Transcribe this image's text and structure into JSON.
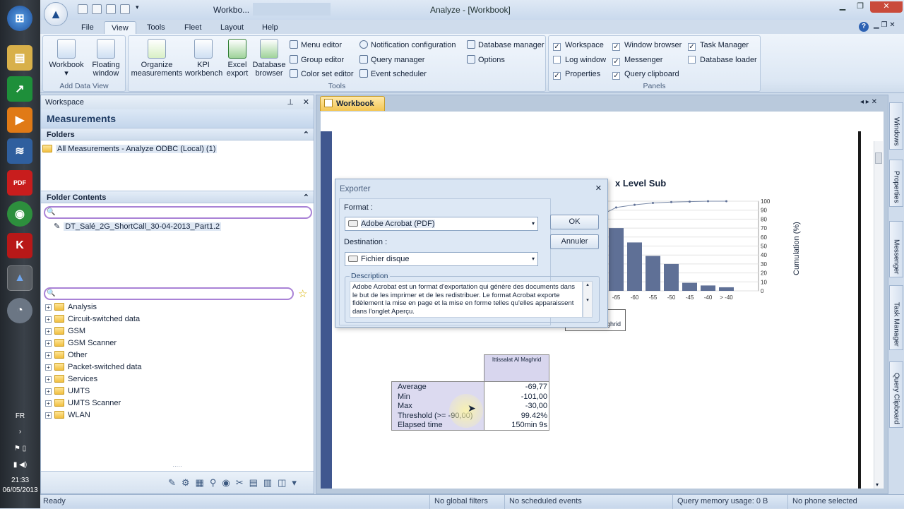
{
  "window": {
    "title": "Analyze - [Workbook]",
    "quick_access_title": "Workbo..."
  },
  "taskbar": {
    "language": "FR",
    "time": "21:33",
    "date": "06/05/2013",
    "pdf_label": "PDF"
  },
  "ribbon_tabs": [
    "File",
    "View",
    "Tools",
    "Fleet",
    "Layout",
    "Help"
  ],
  "active_tab": "View",
  "ribbon": {
    "add_data_view": {
      "label": "Add Data View",
      "workbook": "Workbook",
      "floating_window": "Floating window"
    },
    "tools": {
      "label": "Tools",
      "organize": "Organize measurements",
      "kpi": "KPI workbench",
      "excel": "Excel export",
      "dbbrowser": "Database browser",
      "menu_editor": "Menu editor",
      "group_editor": "Group editor",
      "color_set_editor": "Color set editor",
      "notification": "Notification configuration",
      "query_manager": "Query manager",
      "event_scheduler": "Event scheduler",
      "database_manager": "Database manager",
      "options": "Options"
    },
    "panels": {
      "label": "Panels",
      "items": [
        {
          "label": "Workspace",
          "checked": true
        },
        {
          "label": "Window browser",
          "checked": true
        },
        {
          "label": "Task Manager",
          "checked": true
        },
        {
          "label": "Log window",
          "checked": false
        },
        {
          "label": "Messenger",
          "checked": true
        },
        {
          "label": "Database loader",
          "checked": false
        },
        {
          "label": "Properties",
          "checked": true
        },
        {
          "label": "Query clipboard",
          "checked": true
        }
      ]
    }
  },
  "workspace": {
    "title": "Workspace",
    "heading": "Measurements",
    "folders_header": "Folders",
    "folder_item": "All Measurements - Analyze ODBC (Local) (1)",
    "contents_header": "Folder Contents",
    "file_item": "DT_Salé_2G_ShortCall_30-04-2013_Part1.2",
    "tree": [
      "Analysis",
      "Circuit-switched data",
      "GSM",
      "GSM Scanner",
      "Other",
      "Packet-switched data",
      "Services",
      "UMTS",
      "UMTS Scanner",
      "WLAN"
    ]
  },
  "document": {
    "tab": "Workbook",
    "chart_title_visible": "x Level Sub",
    "y2_label": "Cumulation (%)",
    "legend_partial": "ghrid",
    "table_header": "Ittissalat Al Maghrid",
    "rows": [
      {
        "label": "Average",
        "value": "-69,77"
      },
      {
        "label": "Min",
        "value": "-101,00"
      },
      {
        "label": "Max",
        "value": "-30,00"
      },
      {
        "label": "Threshold (>= -90,00)",
        "value": "99.42%"
      },
      {
        "label": "Elapsed time",
        "value": "150min 9s"
      }
    ]
  },
  "chart_data": {
    "type": "bar",
    "title": "x Level Sub",
    "categories": [
      "-65",
      "-60",
      "-55",
      "-50",
      "-45",
      "-40",
      "> -40"
    ],
    "values": [
      70,
      54,
      39,
      30,
      9,
      6,
      4
    ],
    "cumulative": [
      93,
      96,
      98,
      99,
      99.5,
      100,
      100
    ],
    "y2label": "Cumulation (%)",
    "y2lim": [
      0,
      100
    ],
    "y2ticks": [
      "100",
      "90",
      "80",
      "70",
      "60",
      "50",
      "40",
      "30",
      "20",
      "10",
      "0"
    ]
  },
  "dialog": {
    "title": "Exporter",
    "format_label": "Format :",
    "format_value": "Adobe Acrobat (PDF)",
    "destination_label": "Destination :",
    "destination_value": "Fichier disque",
    "description_label": "Description",
    "description_text": "Adobe Acrobat est un format d'exportation qui génère des documents dans le but de les imprimer et de les redistribuer. Le format Acrobat exporte fidèlement la mise en page et la mise en forme telles qu'elles apparaissent dans l'onglet Aperçu.",
    "ok": "OK",
    "cancel": "Annuler"
  },
  "side_tabs": [
    "Windows",
    "Properties",
    "Messenger",
    "Task Manager",
    "Query Clipboard"
  ],
  "status": {
    "ready": "Ready",
    "filters": "No global filters",
    "events": "No scheduled events",
    "memory": "Query memory usage: 0 B",
    "phone": "No phone selected"
  }
}
